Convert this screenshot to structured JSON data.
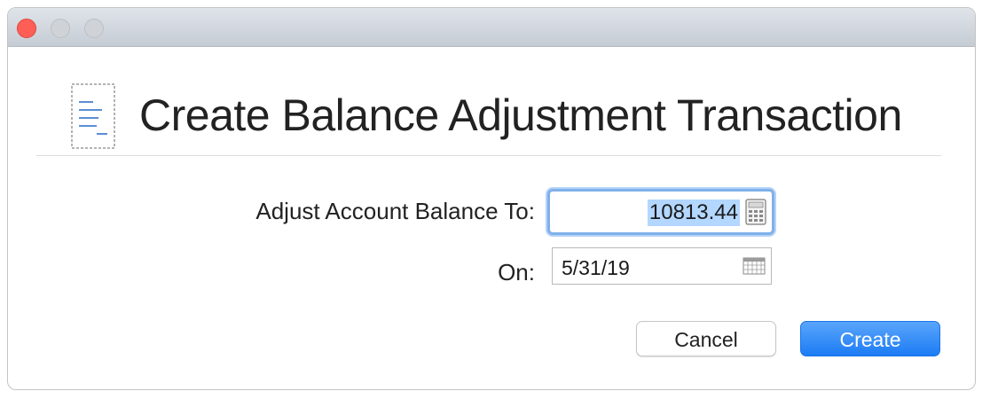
{
  "window": {
    "controls": [
      "close",
      "minimize",
      "zoom"
    ],
    "icon": "receipt-icon"
  },
  "dialog": {
    "title": "Create Balance Adjustment Transaction",
    "fields": {
      "amount_label": "Adjust Account Balance To:",
      "amount_value": "10813.44",
      "amount_icon": "calculator-icon",
      "date_label": "On:",
      "date_value": "5/31/19",
      "date_icon": "calendar-icon"
    },
    "buttons": {
      "cancel_label": "Cancel",
      "create_label": "Create"
    }
  },
  "colors": {
    "close_button": "#fd5f57",
    "accent": "#1c7cf4",
    "selection": "#b3d7ff",
    "focus_ring": "#7fb0ea"
  }
}
